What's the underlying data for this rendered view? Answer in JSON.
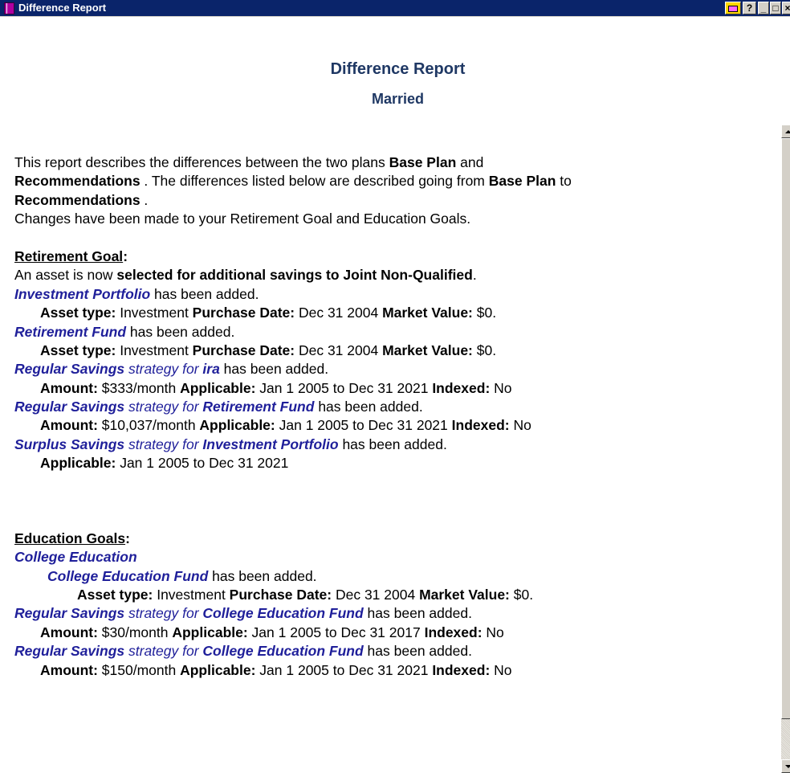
{
  "window": {
    "title": "Difference Report",
    "buttons": {
      "help": "?",
      "minimize": "_",
      "maximize": "□",
      "close": "×"
    },
    "colors": {
      "titlebar": "#0a246a",
      "heading": "#1f3864",
      "item_blue": "#1f1f9a"
    }
  },
  "header": {
    "title": "Difference Report",
    "subtitle": "Married"
  },
  "intro": {
    "l1a": "This report describes the differences between the two plans ",
    "l1b": "Base Plan",
    "l1c": " and",
    "l2a": "Recommendations",
    "l2b": " . The differences listed below are described going from ",
    "l2c": "Base Plan",
    "l2d": " to",
    "l3a": "Recommendations",
    "l3b": " .",
    "l4": "Changes have been made to your Retirement Goal and Education Goals."
  },
  "retirement": {
    "heading": "Retirement Goal",
    "colon": ":",
    "asset_line_a": "An asset is now ",
    "asset_line_b": "selected for additional savings to Joint Non-Qualified",
    "asset_line_c": ".",
    "item1_name": "Investment Portfolio",
    "item1_rest": "  has been added.",
    "item1_d1": "Asset type:",
    "item1_v1": " Investment  ",
    "item1_d2": "Purchase Date:",
    "item1_v2": " Dec 31 2004  ",
    "item1_d3": "Market Value:",
    "item1_v3": " $0.",
    "item2_name": "Retirement Fund",
    "item2_rest": "  has been added.",
    "item2_d1": "Asset type:",
    "item2_v1": " Investment  ",
    "item2_d2": "Purchase Date:",
    "item2_v2": " Dec 31 2004  ",
    "item2_d3": "Market Value:",
    "item2_v3": " $0.",
    "item3_a": "Regular Savings",
    "item3_b": " strategy for ",
    "item3_c": " ira",
    "item3_d": "  has been added.",
    "item3_l1": "Amount:",
    "item3_v1": " $333/month ",
    "item3_l2": "Applicable:",
    "item3_v2": " Jan 1 2005 to Dec 31 2021 ",
    "item3_l3": "Indexed:",
    "item3_v3": " No",
    "item4_a": "Regular Savings",
    "item4_b": " strategy for ",
    "item4_c": " Retirement Fund",
    "item4_d": "  has been added.",
    "item4_l1": "Amount:",
    "item4_v1": " $10,037/month ",
    "item4_l2": "Applicable:",
    "item4_v2": " Jan 1 2005 to Dec 31 2021 ",
    "item4_l3": "Indexed:",
    "item4_v3": " No",
    "item5_a": "Surplus Savings",
    "item5_b": " strategy for ",
    "item5_c": " Investment Portfolio",
    "item5_d": "  has been added.",
    "item5_l1": "Applicable:",
    "item5_v1": " Jan 1 2005 to Dec 31 2021"
  },
  "education": {
    "heading": "Education Goals",
    "colon": ":",
    "goal_name": "College Education",
    "fund_name": "College Education Fund",
    "fund_rest": "  has been added.",
    "fund_d1": "Asset type:",
    "fund_v1": " Investment  ",
    "fund_d2": "Purchase Date:",
    "fund_v2": " Dec 31 2004  ",
    "fund_d3": "Market Value:",
    "fund_v3": " $0.",
    "s1_a": "Regular Savings",
    "s1_b": " strategy for ",
    "s1_c": " College Education Fund",
    "s1_d": "  has been added.",
    "s1_l1": "Amount:",
    "s1_v1": " $30/month ",
    "s1_l2": "Applicable:",
    "s1_v2": " Jan 1 2005 to Dec 31 2017 ",
    "s1_l3": "Indexed:",
    "s1_v3": " No",
    "s2_a": "Regular Savings",
    "s2_b": " strategy for ",
    "s2_c": " College Education Fund",
    "s2_d": "  has been added.",
    "s2_l1": "Amount:",
    "s2_v1": " $150/month ",
    "s2_l2": "Applicable:",
    "s2_v2": " Jan 1 2005 to Dec 31 2021 ",
    "s2_l3": "Indexed:",
    "s2_v3": " No"
  }
}
